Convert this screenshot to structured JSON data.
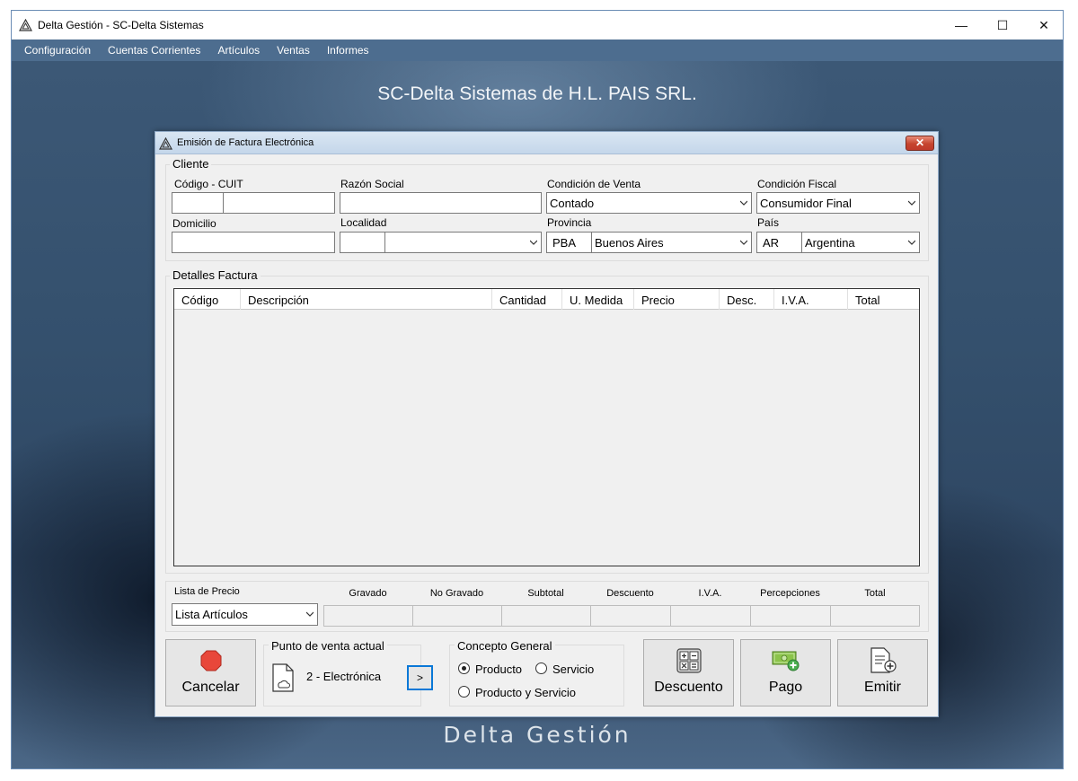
{
  "window": {
    "title": "Delta Gestión - SC-Delta Sistemas",
    "minimize_glyph": "—",
    "maximize_glyph": "☐",
    "close_glyph": "✕"
  },
  "menu": [
    "Configuración",
    "Cuentas Corrientes",
    "Artículos",
    "Ventas",
    "Informes"
  ],
  "desktop": {
    "heading": "SC-Delta Sistemas de H.L. PAIS SRL.",
    "footer": "Delta Gestión"
  },
  "dialog": {
    "title": "Emisión de Factura Electrónica",
    "close_glyph": "✕",
    "cliente": {
      "legend": "Cliente",
      "codigo_label": "Código - CUIT",
      "codigo_value": "",
      "cuit_value": "",
      "razon_label": "Razón Social",
      "razon_value": "",
      "condicion_venta_label": "Condición de Venta",
      "condicion_venta_value": "Contado",
      "condicion_fiscal_label": "Condición Fiscal",
      "condicion_fiscal_value": "Consumidor Final",
      "domicilio_label": "Domicilio",
      "domicilio_value": "",
      "localidad_label": "Localidad",
      "localidad_code": "",
      "localidad_value": "",
      "provincia_label": "Provincia",
      "provincia_code": "PBA",
      "provincia_value": "Buenos Aires",
      "pais_label": "País",
      "pais_code": "AR",
      "pais_value": "Argentina"
    },
    "detalles": {
      "legend": "Detalles Factura",
      "columns": [
        "Código",
        "Descripción",
        "Cantidad",
        "U. Medida",
        "Precio",
        "Desc.",
        "I.V.A.",
        "Total"
      ]
    },
    "totales": {
      "lista_label": "Lista de Precio",
      "lista_value": "Lista Artículos",
      "labels": [
        "Gravado",
        "No Gravado",
        "Subtotal",
        "Descuento",
        "I.V.A.",
        "Percepciones",
        "Total"
      ]
    },
    "buttons": {
      "cancelar": "Cancelar",
      "descuento": "Descuento",
      "pago": "Pago",
      "emitir": "Emitir"
    },
    "punto_venta": {
      "legend": "Punto de venta actual",
      "value": "2 - Electrónica",
      "next_glyph": ">"
    },
    "concepto": {
      "legend": "Concepto General",
      "options": [
        "Producto",
        "Servicio",
        "Producto y Servicio"
      ],
      "selected": "Producto"
    }
  }
}
